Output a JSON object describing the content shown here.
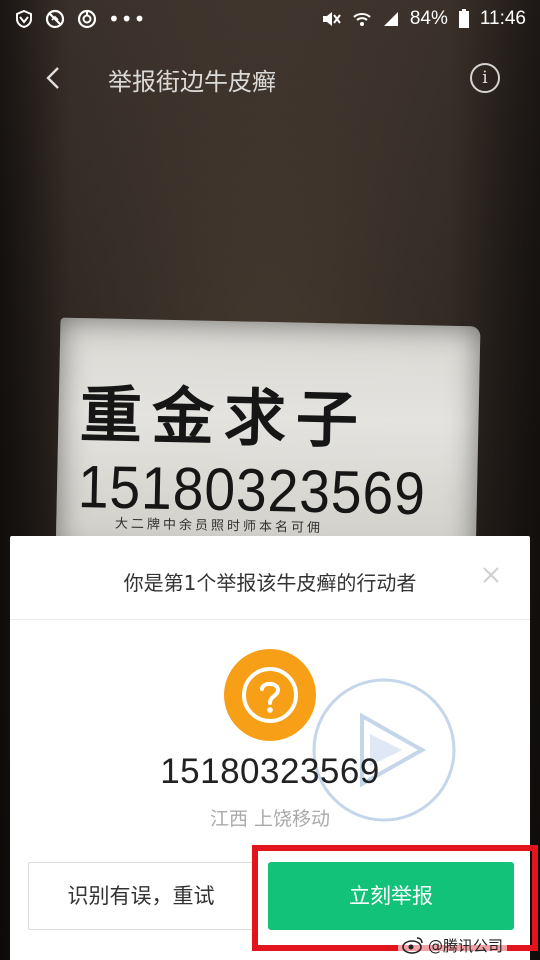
{
  "status_bar": {
    "battery": "84%",
    "time": "11:46",
    "more": "•••",
    "icons": [
      "vpn-shield-icon",
      "blocked-icon",
      "sync-icon",
      "mute-icon",
      "wifi-icon",
      "signal-icon",
      "battery-icon"
    ]
  },
  "header": {
    "title": "举报街边牛皮癣",
    "back_icon": "chevron-left-icon",
    "info_label": "i"
  },
  "photo": {
    "sticker_heading": "重金求子",
    "sticker_phone": "15180323569",
    "sticker_small": "大二牌中余员照时师本名可佣"
  },
  "sheet": {
    "title": "你是第1个举报该牛皮癣的行动者",
    "phone_number": "15180323569",
    "carrier": "江西 上饶移动",
    "retry_label": "识别有误，重试",
    "report_label": "立刻举报",
    "colors": {
      "accent": "#13c279",
      "question": "#f7a017",
      "highlight": "#e2151e"
    }
  },
  "credit": {
    "text": "@腾讯公司"
  }
}
